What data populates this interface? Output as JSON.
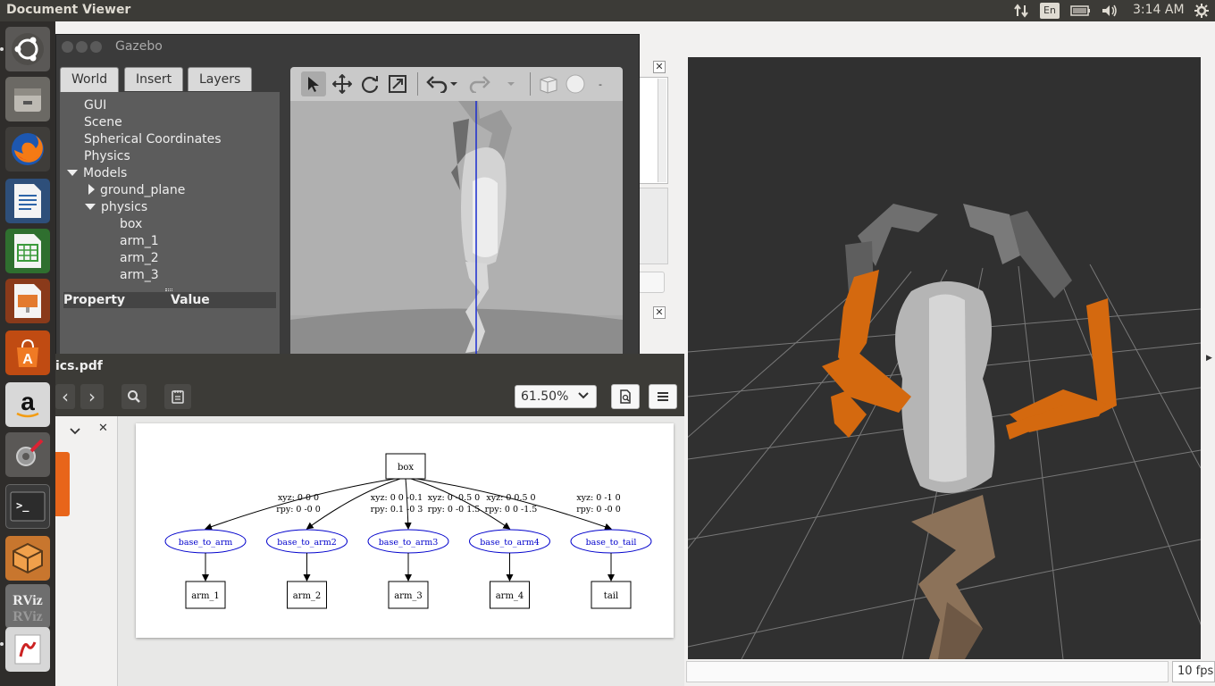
{
  "topbar": {
    "app_title": "Document Viewer",
    "keyboard_layout": "En",
    "time": "3:14 AM",
    "icons": [
      "network-icon",
      "battery-icon",
      "volume-icon",
      "settings-gear-icon"
    ]
  },
  "launcher": {
    "items": [
      {
        "name": "ubuntu-dash-icon"
      },
      {
        "name": "files-icon"
      },
      {
        "name": "firefox-icon"
      },
      {
        "name": "writer-icon"
      },
      {
        "name": "calc-icon"
      },
      {
        "name": "impress-icon"
      },
      {
        "name": "software-center-icon"
      },
      {
        "name": "amazon-icon",
        "label": "a"
      },
      {
        "name": "system-settings-icon"
      },
      {
        "name": "terminal-icon",
        "label": ">_"
      },
      {
        "name": "sublime-box-icon"
      },
      {
        "name": "rviz-icon",
        "label": "RViz"
      },
      {
        "name": "document-viewer-icon"
      }
    ]
  },
  "gazebo": {
    "title": "Gazebo",
    "tabs": [
      "World",
      "Insert",
      "Layers"
    ],
    "active_tab": "World",
    "tree": [
      {
        "label": "GUI",
        "indent": 0,
        "toggle": ""
      },
      {
        "label": "Scene",
        "indent": 0,
        "toggle": ""
      },
      {
        "label": "Spherical Coordinates",
        "indent": 0,
        "toggle": ""
      },
      {
        "label": "Physics",
        "indent": 0,
        "toggle": ""
      },
      {
        "label": "Models",
        "indent": 0,
        "toggle": "expanded"
      },
      {
        "label": "ground_plane",
        "indent": 1,
        "toggle": "collapsed"
      },
      {
        "label": "physics",
        "indent": 1,
        "toggle": "expanded"
      },
      {
        "label": "box",
        "indent": 2,
        "toggle": ""
      },
      {
        "label": "arm_1",
        "indent": 2,
        "toggle": ""
      },
      {
        "label": "arm_2",
        "indent": 2,
        "toggle": ""
      },
      {
        "label": "arm_3",
        "indent": 2,
        "toggle": ""
      }
    ],
    "property_header": "Property",
    "value_header": "Value",
    "toolbar_icons": [
      "select-arrow-icon",
      "translate-icon",
      "rotate-icon",
      "scale-icon",
      "undo-icon",
      "undo-dropdown-icon",
      "redo-icon",
      "redo-dropdown-icon",
      "box-shape-icon",
      "sphere-shape-icon",
      "more-icon"
    ]
  },
  "rviz": {
    "fps": "10 fps"
  },
  "docviewer": {
    "filename": "ics.pdf",
    "zoom": "61.50%",
    "nav": {
      "prev": "‹",
      "next": "›"
    },
    "graph": {
      "root": "box",
      "joints": [
        {
          "joint": "base_to_arm",
          "xyz": "xyz: 0 0 0",
          "rpy": "rpy: 0 -0 0",
          "child": "arm_1"
        },
        {
          "joint": "base_to_arm2",
          "xyz": "xyz: 0 0 -0.1",
          "rpy": "rpy: 0.1 -0 3",
          "child": "arm_2"
        },
        {
          "joint": "base_to_arm3",
          "xyz": "xyz: 0 -0.5 0",
          "rpy": "rpy: 0 -0 1.5",
          "child": "arm_3"
        },
        {
          "joint": "base_to_arm4",
          "xyz": "xyz: 0 0.5 0",
          "rpy": "rpy: 0 0 -1.5",
          "child": "arm_4"
        },
        {
          "joint": "base_to_tail",
          "xyz": "xyz: 0 -1 0",
          "rpy": "rpy: 0 -0 0",
          "child": "tail"
        }
      ]
    }
  },
  "colors": {
    "panel": "#3c3b37",
    "launcher": "#2f2d2b",
    "joint_blue": "#0000cc",
    "robot_orange": "#d4690f",
    "tail_brown": "#8c7259"
  }
}
